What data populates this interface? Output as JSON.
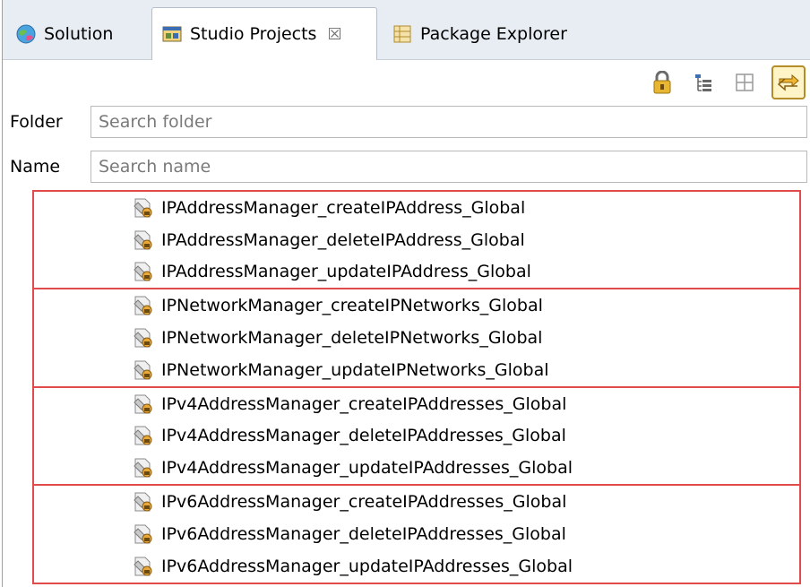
{
  "tabs": [
    {
      "label": "Solution",
      "icon": "globe-icon"
    },
    {
      "label": "Studio Projects",
      "icon": "studio-projects-icon",
      "active": true,
      "close": "☒"
    },
    {
      "label": "Package Explorer",
      "icon": "package-explorer-icon"
    }
  ],
  "toolbar": {
    "buttons": [
      "lock-icon",
      "hierarchy-icon",
      "grid-icon",
      "link-with-editor-icon"
    ]
  },
  "search": {
    "folder_label": "Folder",
    "folder_placeholder": "Search folder",
    "name_label": "Name",
    "name_placeholder": "Search name"
  },
  "groups": [
    {
      "items": [
        "IPAddressManager_createIPAddress_Global",
        "IPAddressManager_deleteIPAddress_Global",
        "IPAddressManager_updateIPAddress_Global"
      ]
    },
    {
      "items": [
        "IPNetworkManager_createIPNetworks_Global",
        "IPNetworkManager_deleteIPNetworks_Global",
        "IPNetworkManager_updateIPNetworks_Global"
      ]
    },
    {
      "items": [
        "IPv4AddressManager_createIPAddresses_Global",
        "IPv4AddressManager_deleteIPAddresses_Global",
        "IPv4AddressManager_updateIPAddresses_Global"
      ]
    },
    {
      "items": [
        "IPv6AddressManager_createIPAddresses_Global",
        "IPv6AddressManager_deleteIPAddresses_Global",
        "IPv6AddressManager_updateIPAddresses_Global"
      ]
    }
  ],
  "colors": {
    "group_border": "#e14b4b",
    "tabbar_bg": "#e8edf3"
  }
}
